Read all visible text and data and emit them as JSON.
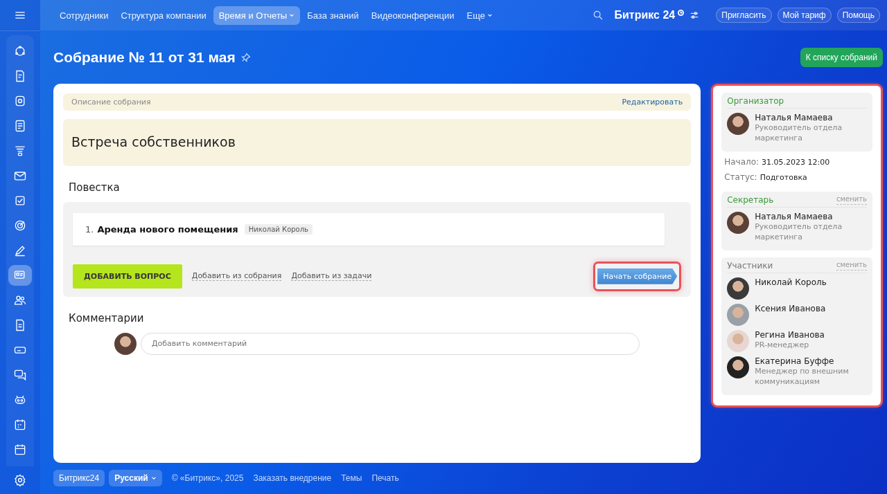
{
  "top_nav": {
    "items": [
      {
        "label": "Сотрудники",
        "selected": false,
        "dropdown": false
      },
      {
        "label": "Структура компании",
        "selected": false,
        "dropdown": false
      },
      {
        "label": "Время и Отчеты",
        "selected": true,
        "dropdown": true
      },
      {
        "label": "База знаний",
        "selected": false,
        "dropdown": false
      },
      {
        "label": "Видеоконференции",
        "selected": false,
        "dropdown": false
      },
      {
        "label": "Еще",
        "selected": false,
        "dropdown": true
      }
    ],
    "logo": "Битрикс 24",
    "buttons": [
      "Пригласить",
      "Мой тариф",
      "Помощь"
    ]
  },
  "sidebar": {
    "items": [
      {
        "selected": false
      },
      {
        "selected": false
      },
      {
        "selected": false
      },
      {
        "selected": false
      },
      {
        "selected": false
      },
      {
        "selected": false
      },
      {
        "selected": false
      },
      {
        "selected": false
      },
      {
        "selected": false
      },
      {
        "selected": true
      },
      {
        "selected": false
      },
      {
        "selected": false
      },
      {
        "selected": false
      },
      {
        "selected": false
      },
      {
        "selected": false
      },
      {
        "selected": false
      },
      {
        "selected": false
      }
    ]
  },
  "page": {
    "title": "Собрание № 11 от 31 мая",
    "back_button": "К списку собраний"
  },
  "description": {
    "label": "Описание собрания",
    "edit_link": "Редактировать",
    "text": "Встреча собственников"
  },
  "agenda": {
    "title": "Повестка",
    "items": [
      {
        "number": "1.",
        "title": "Аренда нового помещения",
        "responsible": "Николай Король"
      }
    ],
    "add_button": "ДОБАВИТЬ ВОПРОС",
    "links": [
      "Добавить из собрания",
      "Добавить из задачи"
    ],
    "start_button": {
      "label": "Начать собрание",
      "highlighted": true
    }
  },
  "comments": {
    "title": "Комментарии",
    "placeholder": "Добавить комментарий"
  },
  "side_panel": {
    "highlighted": true,
    "organizer": {
      "title": "Организатор",
      "person": {
        "name": "Наталья Мамаева",
        "position": "Руководитель отдела маркетинга"
      }
    },
    "fields": [
      {
        "label": "Начало:",
        "value": "31.05.2023 12:00"
      },
      {
        "label": "Статус:",
        "value": "Подготовка"
      }
    ],
    "secretary": {
      "title": "Секретарь",
      "change": "сменить",
      "person": {
        "name": "Наталья Мамаева",
        "position": "Руководитель отдела маркетинга"
      }
    },
    "participants": {
      "title": "Участники",
      "change": "сменить",
      "people": [
        {
          "name": "Николай Король"
        },
        {
          "name": "Ксения Иванова"
        },
        {
          "name": "Регина Иванова",
          "position": "PR-менеджер"
        },
        {
          "name": "Екатерина Буффе",
          "position": "Менеджер по внешним коммуникациям"
        }
      ]
    }
  },
  "footer": {
    "logo": "Битрикс24",
    "language": "Русский",
    "copyright": "© «Битрикс», 2025",
    "links": [
      "Заказать внедрение",
      "Темы",
      "Печать"
    ]
  }
}
